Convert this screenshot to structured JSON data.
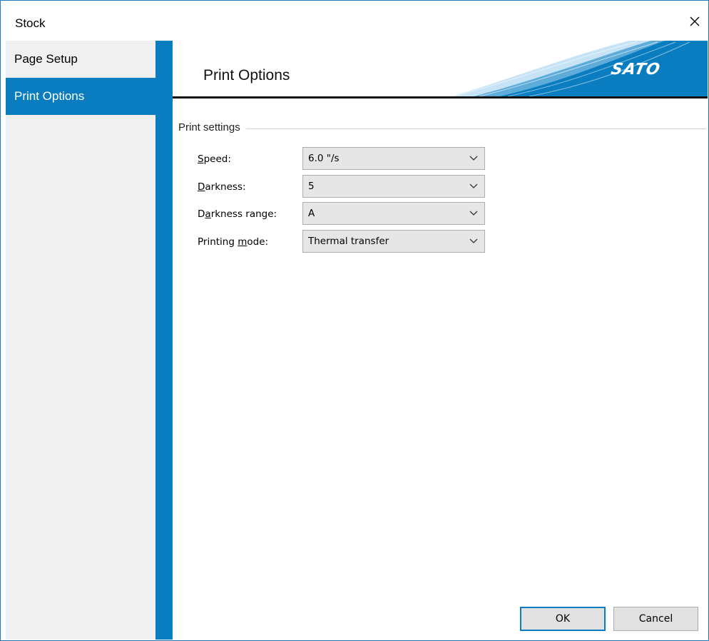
{
  "window": {
    "title": "Stock"
  },
  "sidebar": {
    "items": [
      {
        "label": "Page Setup"
      },
      {
        "label": "Print Options"
      }
    ]
  },
  "banner": {
    "title": "Print Options",
    "logo_text": "SATO"
  },
  "group": {
    "legend": "Print settings",
    "rows": [
      {
        "label_pre": "",
        "label_key": "S",
        "label_post": "peed:",
        "value": "6.0 \"/s"
      },
      {
        "label_pre": "",
        "label_key": "D",
        "label_post": "arkness:",
        "value": "5"
      },
      {
        "label_pre": "D",
        "label_key": "a",
        "label_post": "rkness range:",
        "value": "A"
      },
      {
        "label_pre": "Printing ",
        "label_key": "m",
        "label_post": "ode:",
        "value": "Thermal transfer"
      }
    ]
  },
  "buttons": {
    "ok": "OK",
    "cancel": "Cancel"
  },
  "colors": {
    "accent": "#0a7dc1",
    "sidebar_bg": "#f0f0f0",
    "window_border": "#1f7ac6"
  },
  "icons": {
    "close": "close-icon",
    "dropdown": "chevron-down-icon"
  }
}
